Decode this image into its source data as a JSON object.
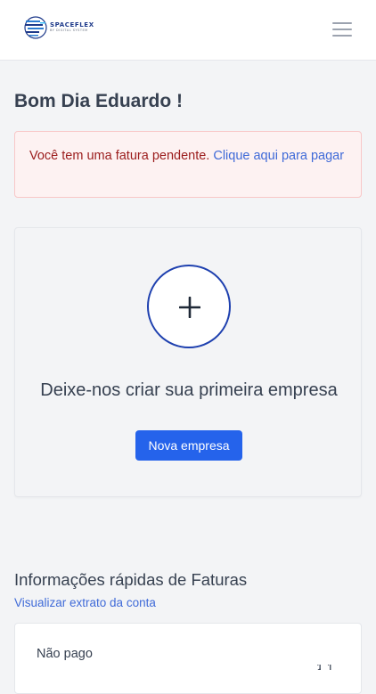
{
  "header": {
    "logo_name": "SPACEFLEX",
    "logo_tagline": "BY DIGITAL SYSTEM",
    "menu_icon": "hamburger-menu-icon"
  },
  "greeting": "Bom Dia Eduardo !",
  "alert": {
    "text": "Você tem uma fatura pendente. ",
    "link": "Clique aqui para pagar"
  },
  "empty_state": {
    "icon": "plus-icon",
    "title": "Deixe-nos criar sua primeira empresa",
    "button_label": "Nova empresa"
  },
  "invoices": {
    "title": "Informações rápidas de Faturas",
    "statement_link": "Visualizar extrato da conta",
    "card_label": "Não pago"
  },
  "colors": {
    "primary": "#2563eb",
    "alert_bg": "#fdf2f2",
    "alert_text": "#9b1c1c",
    "link": "#3f6ad8",
    "brand": "#1e3a8a"
  }
}
